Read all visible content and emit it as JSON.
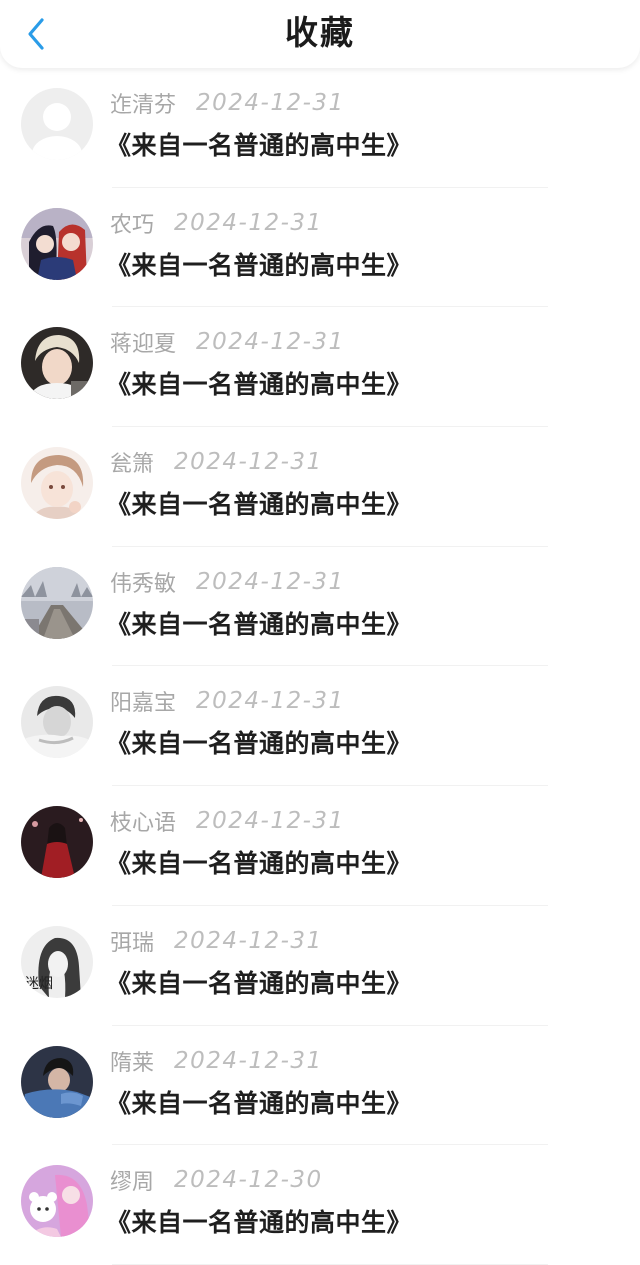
{
  "header": {
    "title": "收藏",
    "back_icon": "chevron-left-icon",
    "accent": "#2a9ce8"
  },
  "items": [
    {
      "name": "迮清芬",
      "date": "2024-12-31",
      "book": "《来自一名普通的高中生》",
      "avatar": "default-avatar-icon"
    },
    {
      "name": "农巧",
      "date": "2024-12-31",
      "book": "《来自一名普通的高中生》",
      "avatar": "anime-couple-avatar"
    },
    {
      "name": "蒋迎夏",
      "date": "2024-12-31",
      "book": "《来自一名普通的高中生》",
      "avatar": "portrait-avatar"
    },
    {
      "name": "瓮箫",
      "date": "2024-12-31",
      "book": "《来自一名普通的高中生》",
      "avatar": "anime-boy-avatar"
    },
    {
      "name": "伟秀敏",
      "date": "2024-12-31",
      "book": "《来自一名普通的高中生》",
      "avatar": "foggy-path-avatar"
    },
    {
      "name": "阳嘉宝",
      "date": "2024-12-31",
      "book": "《来自一名普通的高中生》",
      "avatar": "monochrome-portrait-avatar"
    },
    {
      "name": "枝心语",
      "date": "2024-12-31",
      "book": "《来自一名普通的高中生》",
      "avatar": "red-dress-avatar"
    },
    {
      "name": "弭瑞",
      "date": "2024-12-31",
      "book": "《来自一名普通的高中生》",
      "avatar": "sketch-girl-avatar",
      "avatar_text": "迷烟"
    },
    {
      "name": "隋莱",
      "date": "2024-12-31",
      "book": "《来自一名普通的高中生》",
      "avatar": "blue-hoodie-avatar"
    },
    {
      "name": "缪周",
      "date": "2024-12-30",
      "book": "《来自一名普通的高中生》",
      "avatar": "pink-plush-avatar"
    }
  ]
}
